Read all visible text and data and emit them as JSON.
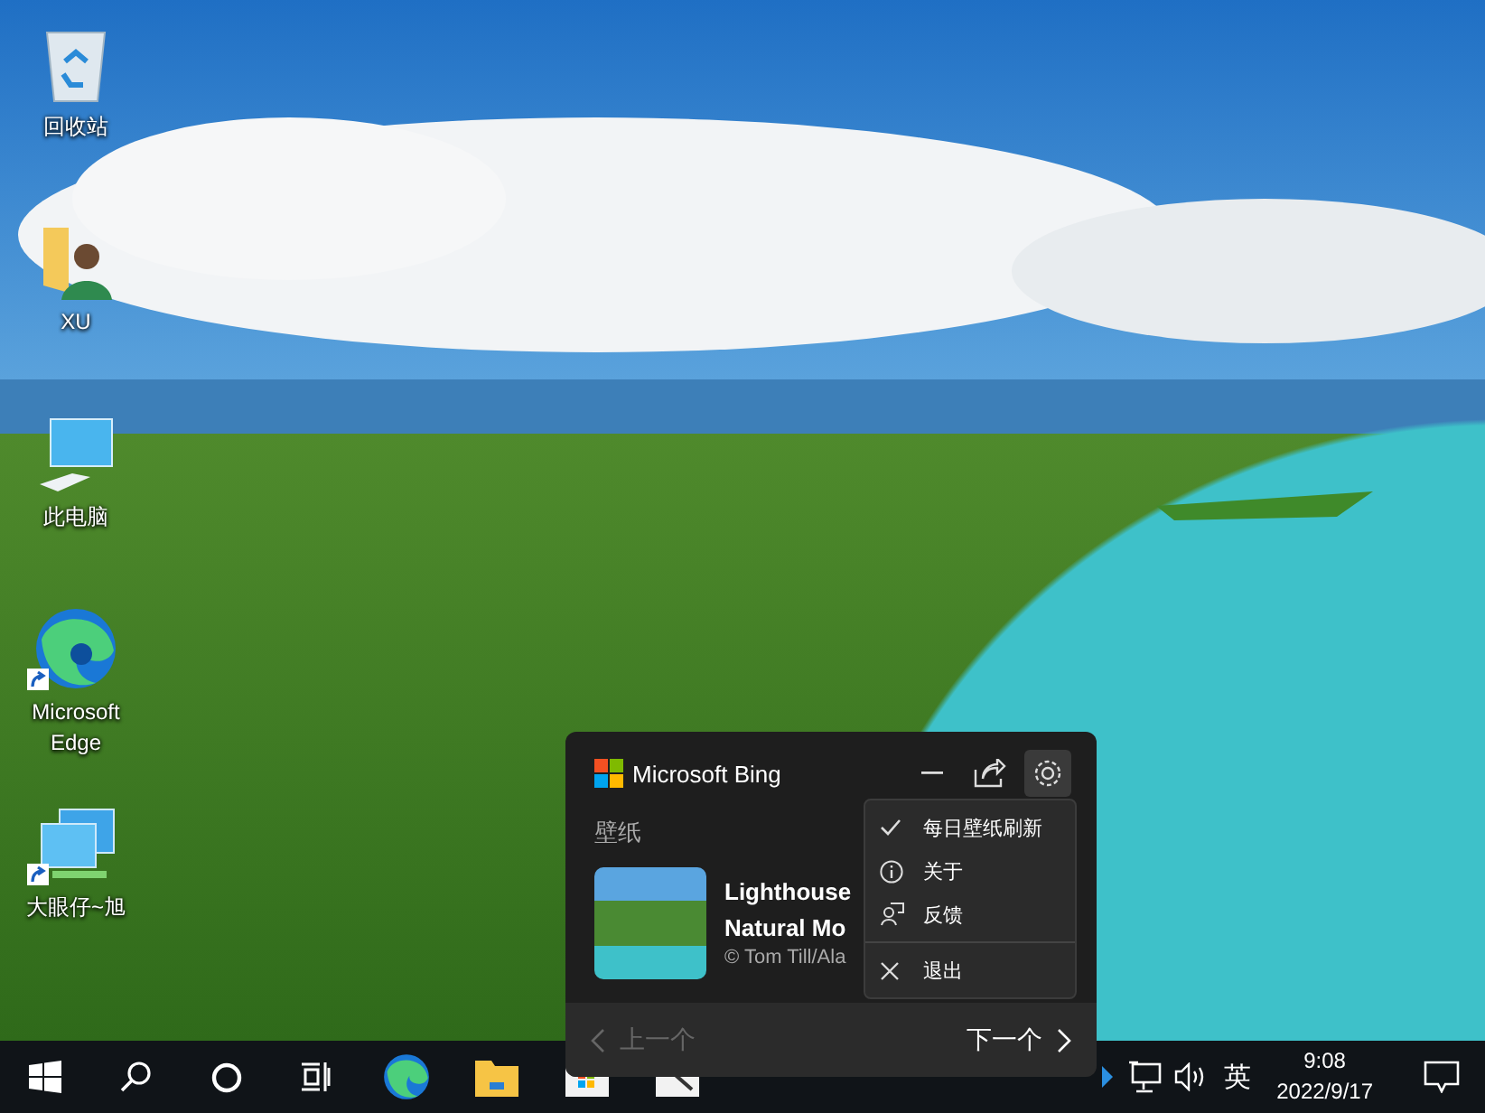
{
  "desktop_icons": [
    {
      "kind": "recycle-bin",
      "label": "回收站",
      "shortcut": false
    },
    {
      "kind": "user-folder",
      "label": "XU",
      "shortcut": false
    },
    {
      "kind": "computer",
      "label": "此电脑",
      "shortcut": false
    },
    {
      "kind": "edge",
      "label": "Microsoft Edge",
      "shortcut": true
    },
    {
      "kind": "monitors",
      "label": "大眼仔~旭",
      "shortcut": true
    }
  ],
  "bing_popup": {
    "brand": "Microsoft Bing",
    "settings_active": true,
    "section": "壁纸",
    "wallpaper": {
      "title_lines": [
        "Lighthouse",
        "Natural Mo"
      ],
      "credit": "© Tom Till/Ala"
    },
    "prev": {
      "label": "上一个",
      "disabled": true
    },
    "next": {
      "label": "下一个",
      "disabled": false
    }
  },
  "settings_menu": [
    {
      "kind": "check",
      "label": "每日壁纸刷新",
      "checked": true
    },
    {
      "kind": "info",
      "label": "关于"
    },
    {
      "kind": "feedback",
      "label": "反馈"
    },
    {
      "kind": "exit",
      "label": "退出"
    }
  ],
  "taskbar": {
    "apps": [
      {
        "kind": "start"
      },
      {
        "kind": "search"
      },
      {
        "kind": "cortana"
      },
      {
        "kind": "task-view"
      },
      {
        "kind": "edge"
      },
      {
        "kind": "explorer"
      },
      {
        "kind": "store"
      },
      {
        "kind": "app"
      }
    ],
    "tray": {
      "input_language": "英",
      "time": "9:08",
      "date": "2022/9/17"
    }
  }
}
